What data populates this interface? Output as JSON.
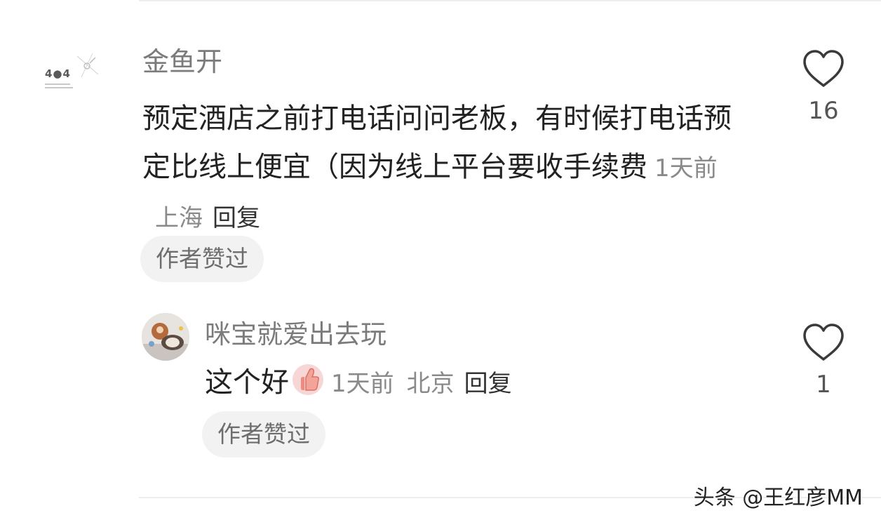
{
  "main_comment": {
    "avatar_text": "4●4",
    "username": "金鱼开",
    "text": "预定酒店之前打电话问问老板，有时候打电话预定比线上便宜（因为线上平台要收手续费",
    "time": "1天前",
    "location": "上海",
    "reply_label": "回复",
    "author_liked": "作者赞过",
    "like_count": "16",
    "like_icon": "heart-outline-icon"
  },
  "reply_comment": {
    "username": "咪宝就爱出去玩",
    "text": "这个好",
    "emoji": "thumbs-up-emoji",
    "time": "1天前",
    "location": "北京",
    "reply_label": "回复",
    "author_liked": "作者赞过",
    "like_count": "1",
    "like_icon": "heart-outline-icon"
  },
  "watermark": "头条 @王红彦MM",
  "colors": {
    "username": "#7b7b7b",
    "text": "#222222",
    "meta": "#8a8a8a",
    "pill_bg": "#f2f2f2"
  }
}
